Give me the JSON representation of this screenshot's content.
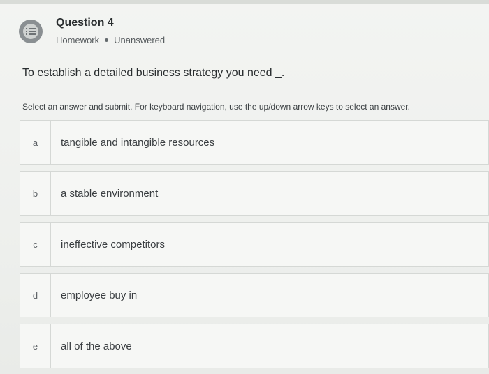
{
  "header": {
    "icon": "question-list-icon",
    "title": "Question 4",
    "type": "Homework",
    "status": "Unanswered"
  },
  "question": {
    "text": "To establish a detailed business strategy you need _."
  },
  "instructions": "Select an answer and submit. For keyboard navigation, use the up/down arrow keys to select an answer.",
  "options": [
    {
      "letter": "a",
      "text": "tangible and intangible resources"
    },
    {
      "letter": "b",
      "text": "a stable environment"
    },
    {
      "letter": "c",
      "text": "ineffective competitors"
    },
    {
      "letter": "d",
      "text": "employee buy in"
    },
    {
      "letter": "e",
      "text": "all of the above"
    }
  ],
  "colors": {
    "background": "#eef0ee",
    "icon_gray": "#8a8f92",
    "text": "#2f3336"
  }
}
